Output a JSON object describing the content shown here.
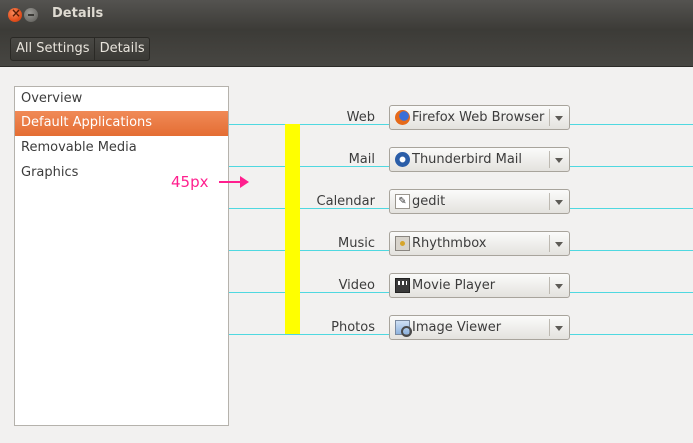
{
  "window": {
    "title": "Details"
  },
  "breadcrumb": [
    "All Settings",
    "Details"
  ],
  "sidebar": {
    "items": [
      {
        "label": "Overview",
        "selected": false
      },
      {
        "label": "Default Applications",
        "selected": true
      },
      {
        "label": "Removable Media",
        "selected": false
      },
      {
        "label": "Graphics",
        "selected": false
      }
    ]
  },
  "annotation": {
    "measure_label": "45px",
    "guide_color": "#4fd8e0",
    "bar_color": "#ffff00",
    "measure_color": "#ff1f8e"
  },
  "defaults": [
    {
      "label": "Web",
      "value": "Firefox Web Browser",
      "icon": "firefox-icon"
    },
    {
      "label": "Mail",
      "value": "Thunderbird Mail",
      "icon": "thunderbird-icon"
    },
    {
      "label": "Calendar",
      "value": "gedit",
      "icon": "gedit-icon"
    },
    {
      "label": "Music",
      "value": "Rhythmbox",
      "icon": "rhythmbox-icon"
    },
    {
      "label": "Video",
      "value": "Movie Player",
      "icon": "movie-player-icon"
    },
    {
      "label": "Photos",
      "value": "Image Viewer",
      "icon": "image-viewer-icon"
    }
  ],
  "colors": {
    "accent": "#e46d33",
    "titlebar": "#3c3b37"
  }
}
